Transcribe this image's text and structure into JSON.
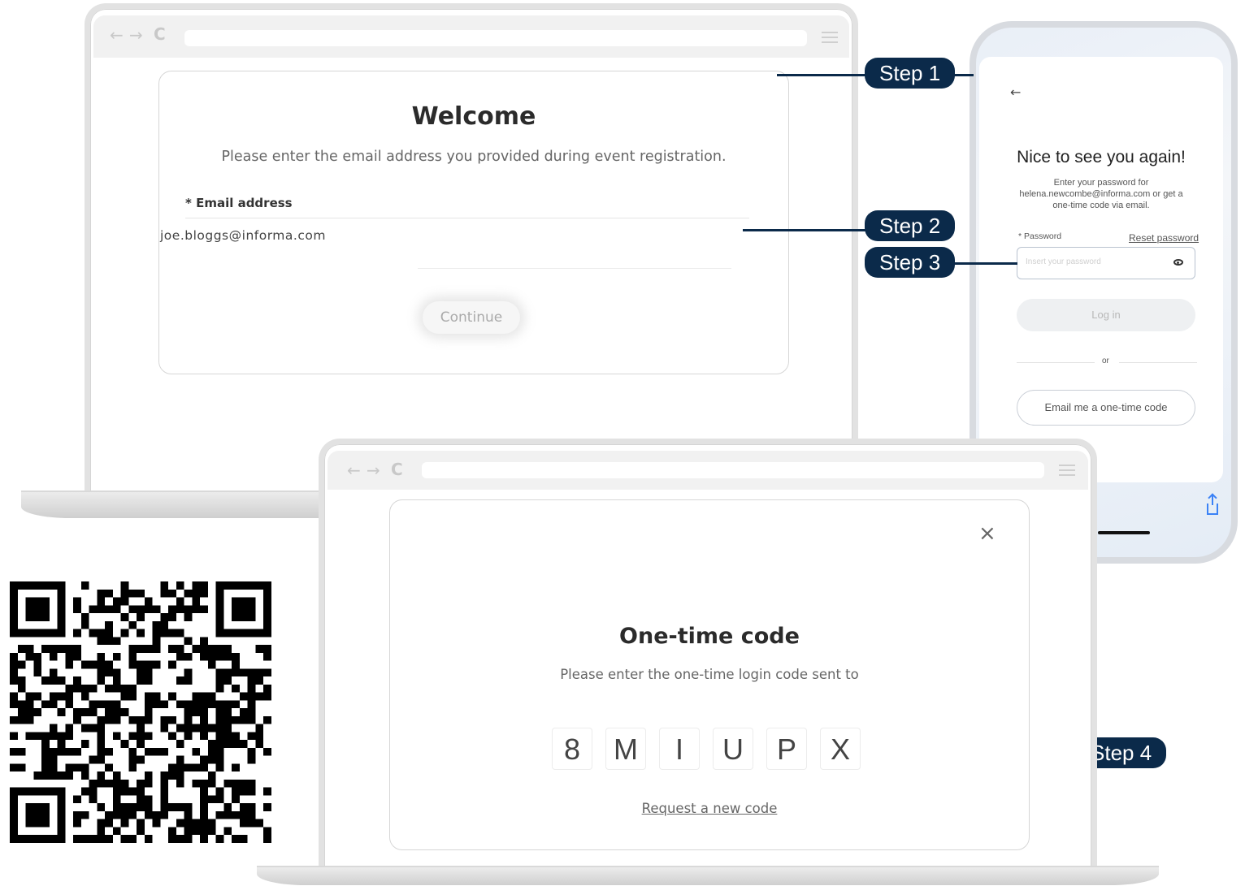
{
  "laptop1": {
    "browser_nav": "← → C",
    "title": "Welcome",
    "subtitle": "Please enter the email address you provided during event registration.",
    "email_label": "* Email address",
    "email_value": "joe.bloggs@informa.com",
    "continue_label": "Continue"
  },
  "phone": {
    "back": "←",
    "title": "Nice to see you again!",
    "subtitle_line1": "Enter your password for",
    "subtitle_line2": "helena.newcombe@informa.com or get a",
    "subtitle_line3": "one-time code via email.",
    "password_label": "* Password",
    "reset_link": "Reset password",
    "password_placeholder": "Insert your password",
    "login_label": "Log in",
    "or_label": "or",
    "otc_button": "Email me a one-time code"
  },
  "laptop2": {
    "browser_nav": "← → C",
    "close": "×",
    "title": "One-time code",
    "subtitle": "Please enter the one-time login code sent to",
    "code": [
      "8",
      "M",
      "I",
      "U",
      "P",
      "X"
    ],
    "request_link": "Request a new code"
  },
  "steps": {
    "step1": "Step 1",
    "step2": "Step 2",
    "step3": "Step 3",
    "step4": "Step 4"
  },
  "colors": {
    "step_badge": "#0b2a4a",
    "device_frame": "#e2e2e2"
  }
}
